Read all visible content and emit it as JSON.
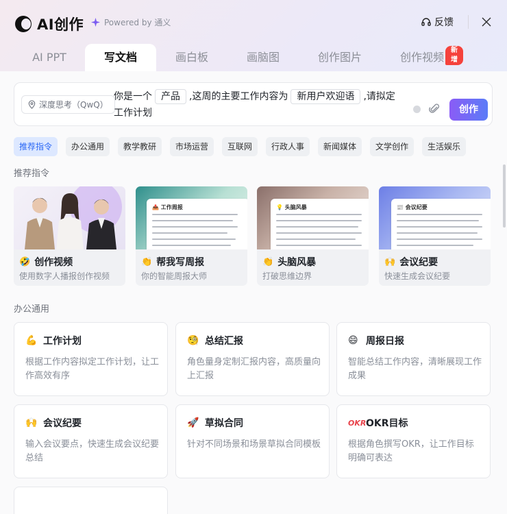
{
  "app": {
    "title": "AI创作",
    "powered_by": "Powered by 通义"
  },
  "header": {
    "feedback_label": "反馈"
  },
  "tabs": [
    {
      "label": "AI PPT"
    },
    {
      "label": "写文档",
      "active": true
    },
    {
      "label": "画白板"
    },
    {
      "label": "画脑图"
    },
    {
      "label": "创作图片"
    },
    {
      "label": "创作视频",
      "badge": "新增"
    }
  ],
  "input": {
    "model": "深度思考（QwQ）",
    "prefix": "你是一个",
    "slot1": "产品",
    "middle": ",这周的主要工作内容为",
    "slot2": "新用户欢迎语",
    "suffix": ",请拟定",
    "line2": "工作计划",
    "create_label": "创作"
  },
  "filters": [
    {
      "label": "推荐指令",
      "active": true
    },
    {
      "label": "办公通用"
    },
    {
      "label": "教学教研"
    },
    {
      "label": "市场运营"
    },
    {
      "label": "互联网"
    },
    {
      "label": "行政人事"
    },
    {
      "label": "新闻媒体"
    },
    {
      "label": "文学创作"
    },
    {
      "label": "生活娱乐"
    }
  ],
  "sections": {
    "recommended": "推荐指令",
    "office": "办公通用"
  },
  "featured": [
    {
      "title": "创作视频",
      "subtitle": "使用数字人播报创作视频",
      "emoji": "🤣"
    },
    {
      "title": "帮我写周报",
      "subtitle": "你的智能周报大师",
      "emoji": "👏",
      "doc_title": "📤 工作周报"
    },
    {
      "title": "头脑风暴",
      "subtitle": "打破思维边界",
      "emoji": "👏",
      "doc_title": "💡 头脑风暴"
    },
    {
      "title": "会议纪要",
      "subtitle": "快速生成会议纪要",
      "emoji": "🙌",
      "doc_title": "📰 会议纪要"
    }
  ],
  "office_cards": [
    {
      "title": "工作计划",
      "desc": "根据工作内容拟定工作计划，让工作高效有序",
      "emoji": "💪"
    },
    {
      "title": "总结汇报",
      "desc": "角色量身定制汇报内容，高质量向上汇报",
      "emoji": "🧐"
    },
    {
      "title": "周报日报",
      "desc": "智能总结工作内容，清晰展现工作成果",
      "emoji": "😄"
    },
    {
      "title": "会议纪要",
      "desc": "输入会议要点，快速生成会议纪要总结",
      "emoji": "🙌"
    },
    {
      "title": "草拟合同",
      "desc": "针对不同场景和场景草拟合同模板",
      "emoji": "🚀"
    },
    {
      "title": "OKR目标",
      "desc": "根据角色撰写OKR，让工作目标明确可表达",
      "emoji": "OKR"
    }
  ],
  "colors": {
    "accent": "#2a67f5",
    "create_gradient_start": "#8a5cf6",
    "create_gradient_end": "#5b7cf7",
    "badge": "#f5423c"
  }
}
